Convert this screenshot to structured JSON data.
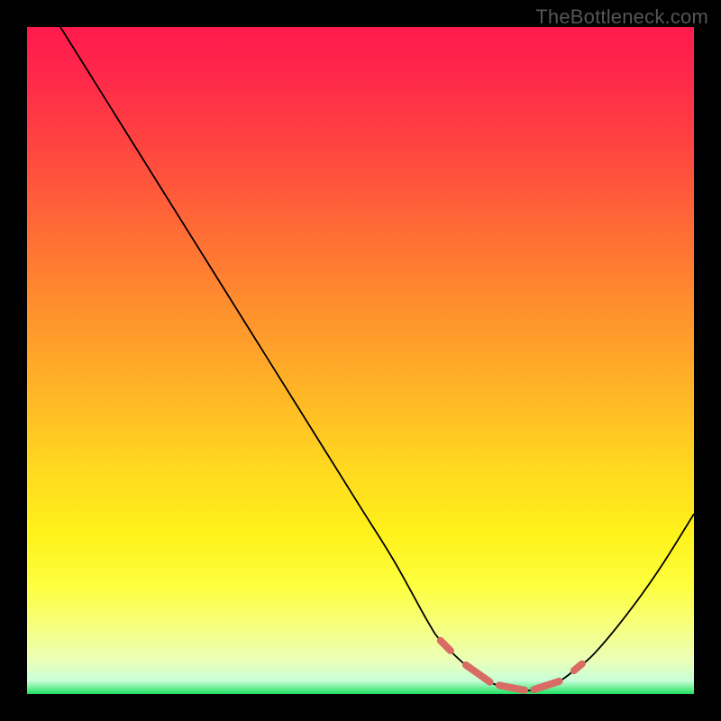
{
  "watermark": "TheBottleneck.com",
  "chart_data": {
    "type": "line",
    "title": "",
    "xlabel": "",
    "ylabel": "",
    "xlim": [
      0,
      100
    ],
    "ylim": [
      0,
      100
    ],
    "grid": false,
    "legend": false,
    "series": [
      {
        "name": "bottleneck-curve",
        "description": "V-shaped curve; y appears to represent mismatch/bottleneck percentage, minimized near x≈75",
        "x": [
          5,
          10,
          15,
          20,
          25,
          30,
          35,
          40,
          45,
          50,
          55,
          60,
          62,
          65,
          68,
          70,
          72,
          75,
          78,
          80,
          82,
          85,
          90,
          95,
          100
        ],
        "y": [
          100,
          92,
          84,
          76,
          68,
          60,
          52,
          44,
          36,
          28,
          20,
          11,
          8,
          5,
          2.5,
          1.5,
          1,
          0.5,
          1,
          2,
          3.5,
          6,
          12,
          19,
          27
        ],
        "stroke": "#000000"
      }
    ],
    "annotations": [
      {
        "name": "optimal-region-dashes",
        "description": "pink dashed markers near the curve minimum indicating low-bottleneck region",
        "color": "#d86b63",
        "approx_x_range": [
          62,
          83
        ],
        "approx_y": 1
      }
    ],
    "background_gradient": {
      "orientation": "vertical",
      "stops": [
        {
          "pos": 0.0,
          "color": "#ff1a4d"
        },
        {
          "pos": 0.5,
          "color": "#ffb000"
        },
        {
          "pos": 0.85,
          "color": "#fff21a"
        },
        {
          "pos": 1.0,
          "color": "#22e060"
        }
      ],
      "meaning": "red=high bottleneck, green=low bottleneck"
    }
  }
}
